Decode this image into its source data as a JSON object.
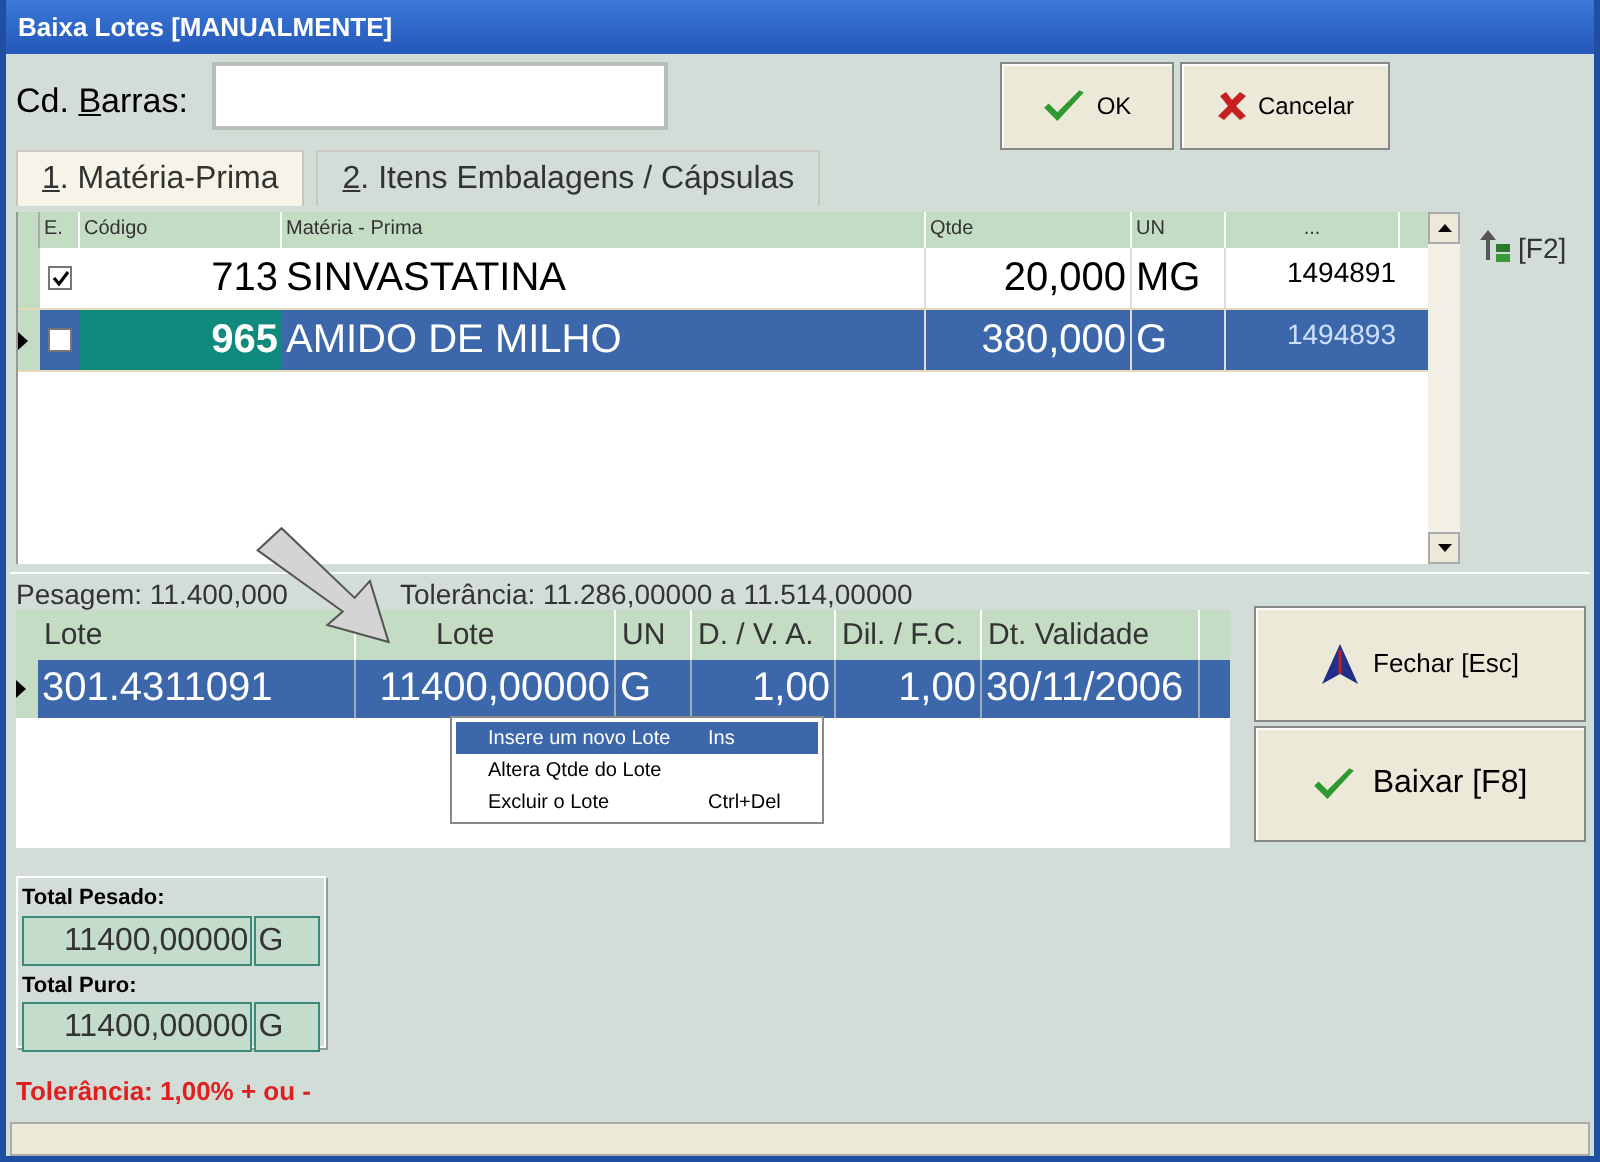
{
  "window": {
    "title": "Baixa Lotes [MANUALMENTE]"
  },
  "barcode": {
    "before": "Cd. ",
    "accel": "B",
    "after": "arras:"
  },
  "buttons": [
    {
      "kind": "ok",
      "label": "OK"
    },
    {
      "kind": "cancel",
      "label": "Cancelar"
    }
  ],
  "tabs": [
    {
      "num": "1",
      "label": ". Matéria-Prima",
      "selected": true
    },
    {
      "num": "2",
      "label": ". Itens Embalagens / Cápsulas",
      "selected": false
    }
  ],
  "materials": {
    "columns": [
      "E.",
      "Código",
      "Matéria - Prima",
      "Qtde",
      "UN",
      "..."
    ],
    "rows": [
      {
        "checked": true,
        "selected": false,
        "code": "713",
        "name": "SINVASTATINA",
        "qty": "20,000",
        "unit": "MG",
        "ref": "1494891"
      },
      {
        "checked": false,
        "selected": true,
        "code": "965",
        "name": "AMIDO DE MILHO",
        "qty": "380,000",
        "unit": "G",
        "ref": "1494893"
      }
    ]
  },
  "f2": {
    "label": "[F2]"
  },
  "weighing": {
    "label_left": "Pesagem: 11.400,000",
    "label_right": "Tolerância: 11.286,00000 a 11.514,00000",
    "columns": [
      "Lote",
      "Lote",
      "UN",
      "D. / V. A.",
      "Dil. / F.C.",
      "Dt. Validade"
    ],
    "rows": [
      {
        "selected": true,
        "cells": [
          "301.4311091",
          "11400,00000",
          "G",
          "1,00",
          "1,00",
          "30/11/2006"
        ]
      }
    ]
  },
  "context_menu": [
    {
      "label": "Insere um novo Lote",
      "shortcut": "Ins",
      "selected": true
    },
    {
      "label": "Altera Qtde do Lote",
      "selected": false
    },
    {
      "label": "Excluir o Lote",
      "shortcut": "Ctrl+Del",
      "selected": false
    }
  ],
  "side_buttons": [
    {
      "kind": "close",
      "label": "Fechar [Esc]"
    },
    {
      "kind": "confirm",
      "label": "Baixar [F8]"
    }
  ],
  "totals": [
    {
      "label": "Total Pesado:",
      "value": "11400,00000",
      "unit": "G"
    },
    {
      "label": "Total Puro:",
      "value": "11400,00000",
      "unit": "G"
    }
  ],
  "tolerance": "Tolerância: 1,00% + ou -"
}
